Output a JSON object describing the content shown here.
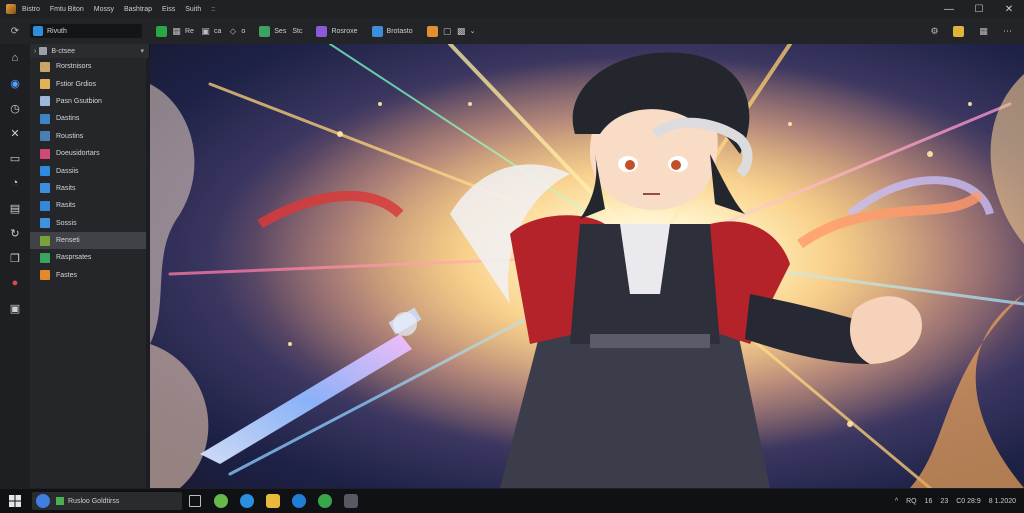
{
  "titlebar": {
    "menu": [
      "Bistro",
      "Fmtu Biton",
      "Mossy",
      "Bashtrap",
      "Eiss",
      "Suith",
      "::"
    ],
    "controls": [
      "—",
      "☐",
      "✕"
    ]
  },
  "toolbar": {
    "address_text": "Rivuth",
    "tools": [
      {
        "type": "square",
        "color": "#27a845"
      },
      {
        "type": "glyph",
        "glyph": "▦"
      },
      {
        "type": "text",
        "text": "Re"
      },
      {
        "type": "glyph",
        "glyph": "▣"
      },
      {
        "type": "text",
        "text": "ca"
      },
      {
        "type": "glyph",
        "glyph": "⬦"
      },
      {
        "type": "text",
        "text": "o"
      },
      {
        "type": "square",
        "color": "#3aa35d"
      },
      {
        "type": "text",
        "text": "Ses"
      },
      {
        "type": "text",
        "text": "Stc"
      },
      {
        "type": "square",
        "color": "#8b5ad9"
      },
      {
        "type": "text",
        "text": "Rosroxe"
      },
      {
        "type": "square",
        "color": "#3c8edb"
      },
      {
        "type": "text",
        "text": "Brotasto"
      },
      {
        "type": "square",
        "color": "#e0902c"
      },
      {
        "type": "glyph",
        "glyph": "▢"
      },
      {
        "type": "glyph",
        "glyph": "▩"
      },
      {
        "type": "text",
        "text": "⌄"
      }
    ]
  },
  "tree": {
    "header_label": "B-ctsee",
    "items": [
      {
        "label": "Rorstnisors",
        "color": "#c8a468"
      },
      {
        "label": "Fstior Grdios",
        "color": "#e0b25a"
      },
      {
        "label": "Pasn Gsutbion",
        "color": "#9db9d9"
      },
      {
        "label": "Dastins",
        "color": "#3c86c7"
      },
      {
        "label": "Roustins",
        "color": "#4a7fb3"
      },
      {
        "label": "Doeusidortars",
        "color": "#d14a76"
      },
      {
        "label": "Dassiis",
        "color": "#2f8be0"
      },
      {
        "label": "Rasits",
        "color": "#3c8fe0"
      },
      {
        "label": "Rasits",
        "color": "#3389d8"
      },
      {
        "label": "Sossis",
        "color": "#3f92e0"
      },
      {
        "label": "Renseti",
        "color": "#7aa23a",
        "selected": true
      },
      {
        "label": "Rasprsates",
        "color": "#3aa35d"
      },
      {
        "label": "Fastes",
        "color": "#e08a2c"
      }
    ]
  },
  "taskbar": {
    "search_text": "Rusloo Goldtirss",
    "tray": [
      "^",
      "RQ",
      "16",
      "23",
      "C0 28:9",
      "8 1.2020"
    ]
  },
  "colors": {
    "accent": "#4fa3ff",
    "panel": "#25262a",
    "selected": "#404247"
  }
}
